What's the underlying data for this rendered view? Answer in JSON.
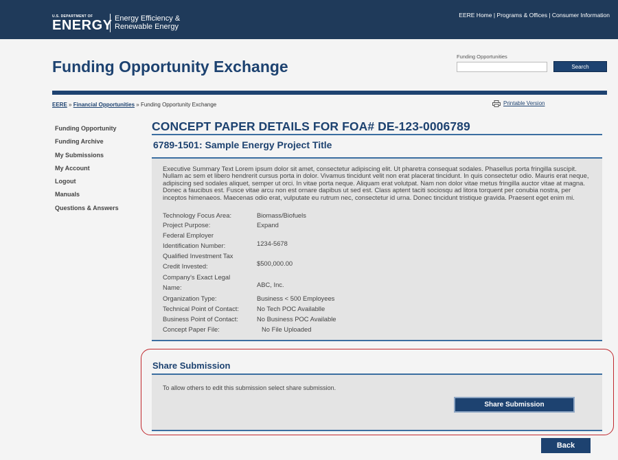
{
  "topbar": {
    "dept_small": "U.S. DEPARTMENT OF",
    "dept_big": "ENERGY",
    "office_line1": "Energy Efficiency &",
    "office_line2": "Renewable Energy",
    "links": [
      "EERE Home",
      "Programs & Offices",
      "Consumer Information"
    ],
    "separator": " | "
  },
  "header": {
    "title": "Funding Opportunity Exchange",
    "search_label": "Funding Opportunities",
    "search_value": "",
    "search_button": "Search"
  },
  "breadcrumb": {
    "items": [
      "EERE",
      "Financial Opportunities",
      "Funding Opportunity Exchange"
    ],
    "separator": " » "
  },
  "printable": "Printable Version",
  "sidebar": {
    "items": [
      "Funding Opportunity",
      "Funding Archive",
      "My Submissions",
      "My Account",
      "Logout",
      "Manuals",
      "Questions & Answers"
    ]
  },
  "main": {
    "title": "CONCEPT PAPER DETAILS FOR FOA# DE-123-0006789",
    "subtitle": "6789-1501: Sample Energy Project Title",
    "summary": "Executive Summary Text Lorem ipsum dolor sit amet, consectetur adipiscing elit. Ut pharetra consequat sodales. Phasellus porta fringilla suscipit. Nullam ac sem et libero hendrerit cursus porta in dolor. Vivamus tincidunt velit non erat placerat tincidunt. In quis consectetur odio. Mauris erat neque, adipiscing sed sodales aliquet, semper ut orci. In vitae porta neque. Aliquam erat volutpat. Nam non dolor vitae metus fringilla auctor vitae at magna. Donec a faucibus est. Fusce vitae arcu non est ornare dapibus ut sed est. Class aptent taciti sociosqu ad litora torquent per conubia nostra, per inceptos himenaeos. Maecenas odio erat, vulputate eu rutrum nec, consectetur id urna. Donec tincidunt tristique gravida. Praesent eget enim mi.",
    "fields": [
      {
        "label": "Technology Focus Area:",
        "value": "Biomass/Biofuels"
      },
      {
        "label": "Project Purpose:",
        "value": "Expand"
      },
      {
        "label_line1": "Federal Employer",
        "label_line2": "Identification Number:",
        "value": "1234-5678"
      },
      {
        "label_line1": "Qualified Investment Tax",
        "label_line2": "Credit Invested:",
        "value": "$500,000.00"
      },
      {
        "label_line1": "Company's Exact Legal",
        "label_line2": "Name:",
        "value": "ABC, Inc."
      },
      {
        "label": "Organization Type:",
        "value": "Business < 500 Employees"
      },
      {
        "label": "Technical Point of Contact:",
        "value": "No Tech POC Availablle"
      },
      {
        "label": "Business Point of Contact:",
        "value": "No Business POC Available"
      },
      {
        "label": "Concept Paper File:",
        "value": "No File Uploaded"
      }
    ]
  },
  "share": {
    "title": "Share Submission",
    "text": "To allow others to edit this submission select share submission.",
    "button": "Share Submission"
  },
  "back_button": "Back",
  "colors": {
    "navy": "#1d4270",
    "topbar": "#1f3a5a",
    "panel": "#e4e4e4",
    "highlight": "#c0272d"
  }
}
